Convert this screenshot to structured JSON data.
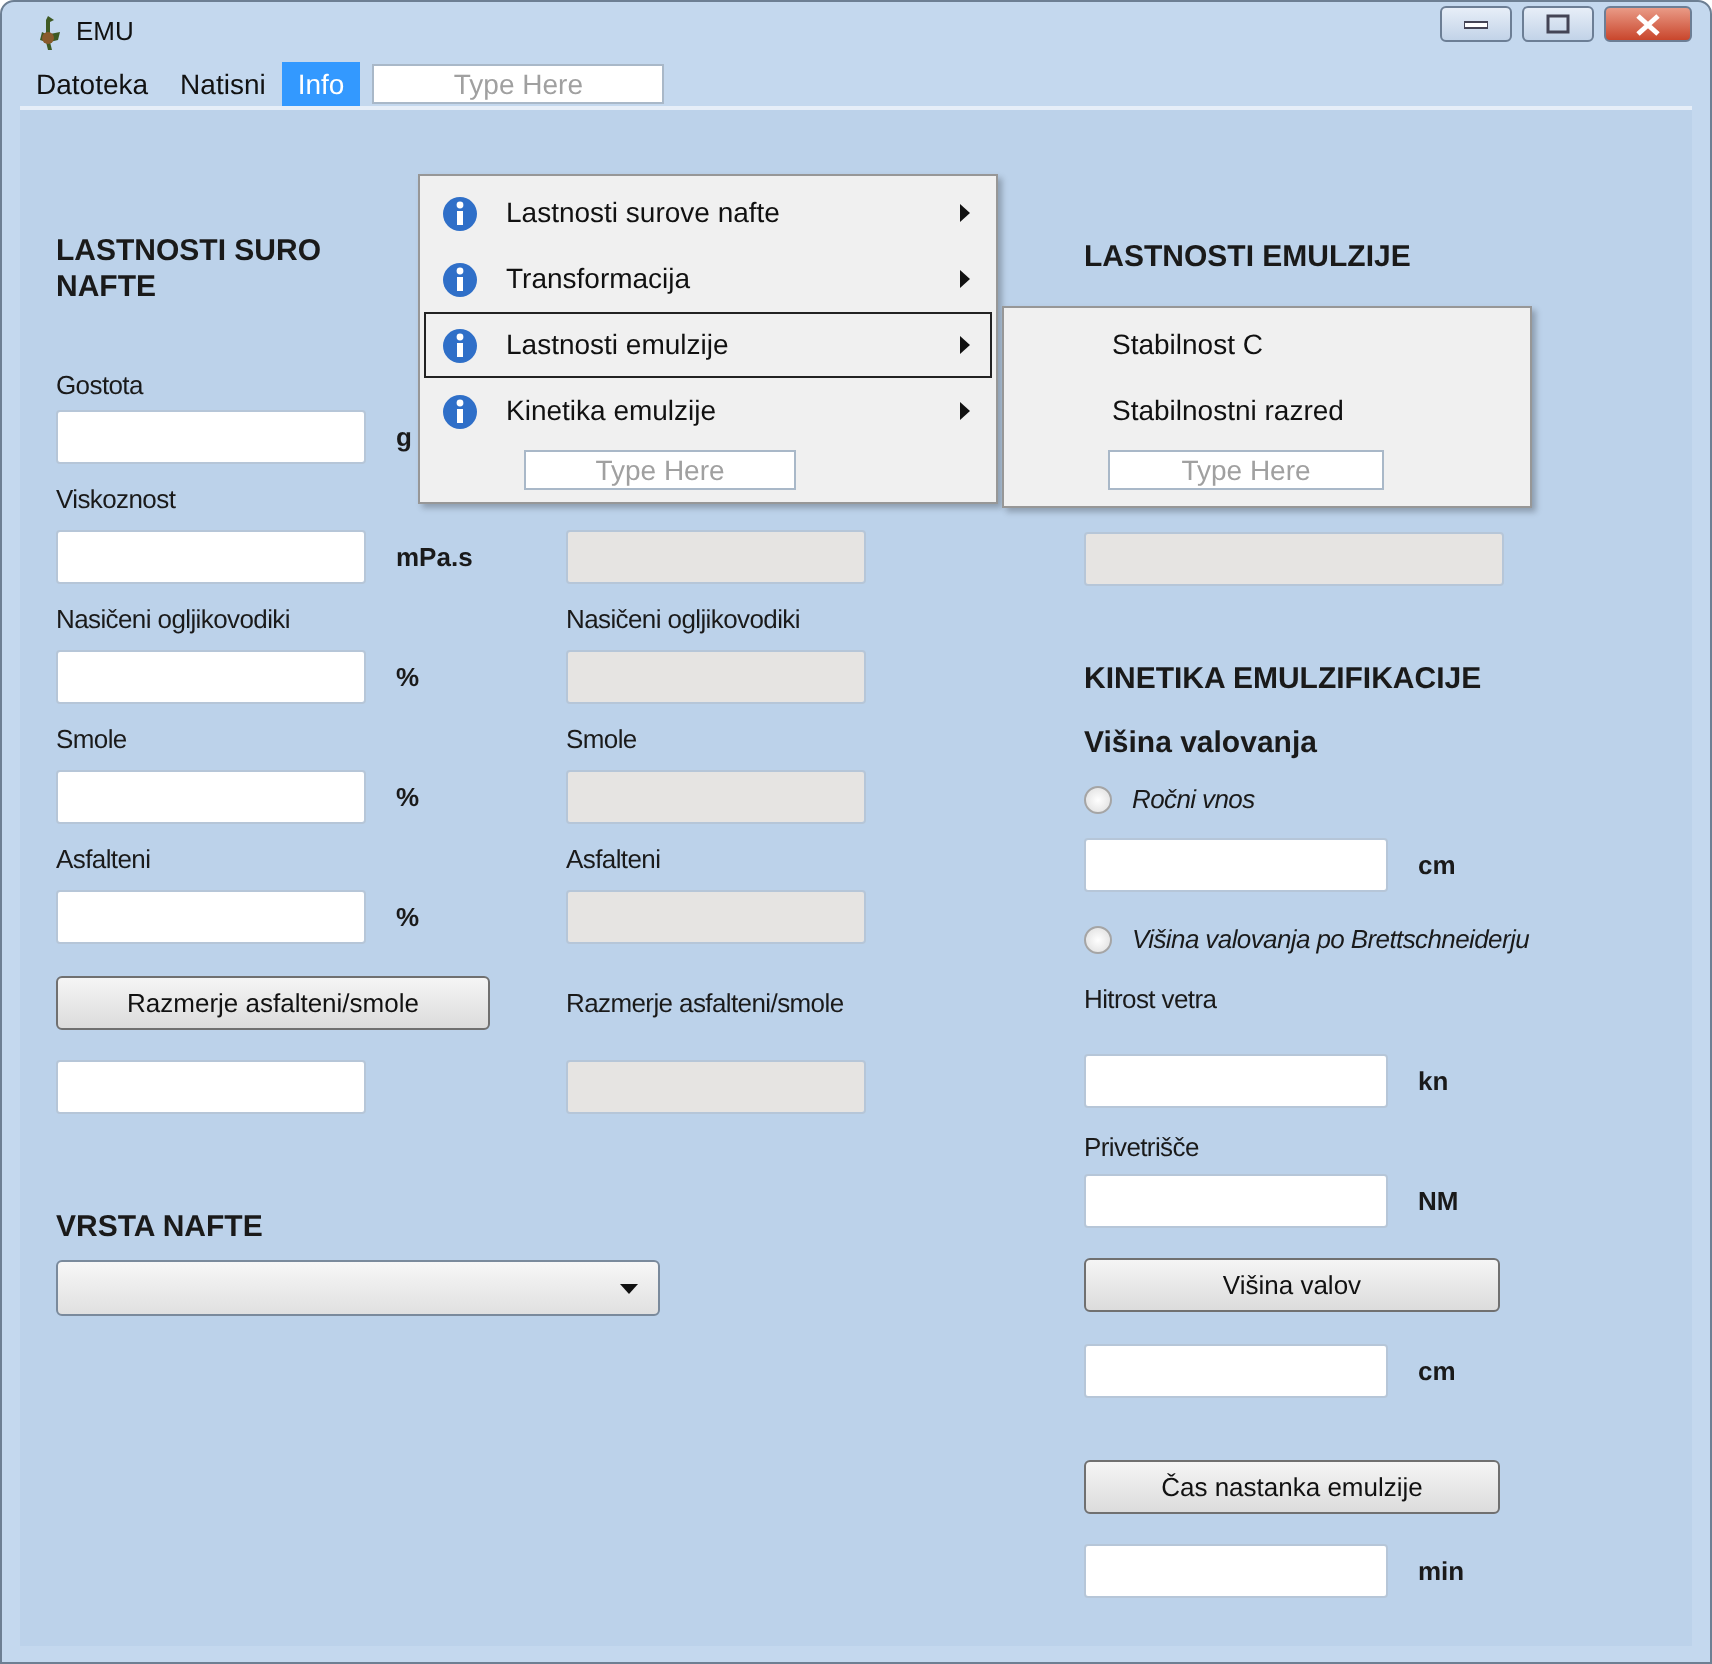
{
  "window": {
    "title": "EMU"
  },
  "menu_bar": {
    "items": [
      {
        "label": "Datoteka",
        "selected": false
      },
      {
        "label": "Natisni",
        "selected": false
      },
      {
        "label": "Info",
        "selected": true
      }
    ],
    "placeholder": "Type Here"
  },
  "info_menu": {
    "items": [
      {
        "label": "Lastnosti surove nafte",
        "selected": false
      },
      {
        "label": "Transformacija",
        "selected": false
      },
      {
        "label": "Lastnosti emulzije",
        "selected": true
      },
      {
        "label": "Kinetika emulzije",
        "selected": false
      }
    ],
    "placeholder": "Type Here"
  },
  "submenu": {
    "items": [
      {
        "label": "Stabilnost C"
      },
      {
        "label": "Stabilnostni razred"
      }
    ],
    "placeholder": "Type Here"
  },
  "columns": [
    {
      "items": [
        {
          "kind": "heading",
          "text": "LASTNOSTI SURO\nNAFTE"
        },
        {
          "kind": "label",
          "text": "Gostota"
        },
        {
          "kind": "field",
          "unit": "g",
          "disabled": false
        },
        {
          "kind": "label",
          "text": "Viskoznost"
        },
        {
          "kind": "field",
          "unit": "mPa.s",
          "disabled": false
        },
        {
          "kind": "label",
          "text": "Nasičeni ogljikovodiki"
        },
        {
          "kind": "field",
          "unit": "%",
          "disabled": false
        },
        {
          "kind": "label",
          "text": "Smole"
        },
        {
          "kind": "field",
          "unit": "%",
          "disabled": false
        },
        {
          "kind": "label",
          "text": "Asfalteni"
        },
        {
          "kind": "field",
          "unit": "%",
          "disabled": false
        },
        {
          "kind": "button",
          "text": "Razmerje asfalteni/smole"
        },
        {
          "kind": "field",
          "disabled": false
        },
        {
          "kind": "heading",
          "text": "VRSTA NAFTE"
        },
        {
          "kind": "select"
        }
      ]
    },
    {
      "items": [
        {
          "kind": "field",
          "disabled": true
        },
        {
          "kind": "label",
          "text": "Nasičeni ogljikovodiki"
        },
        {
          "kind": "field",
          "disabled": true
        },
        {
          "kind": "label",
          "text": "Smole"
        },
        {
          "kind": "field",
          "disabled": true
        },
        {
          "kind": "label",
          "text": "Asfalteni"
        },
        {
          "kind": "field",
          "disabled": true
        },
        {
          "kind": "label",
          "text": "Razmerje asfalteni/smole"
        },
        {
          "kind": "field",
          "disabled": true
        }
      ]
    },
    {
      "items": [
        {
          "kind": "heading",
          "text": "LASTNOSTI EMULZIJE"
        },
        {
          "kind": "field",
          "disabled": true
        },
        {
          "kind": "heading",
          "text": "KINETIKA EMULZIFIKACIJE"
        },
        {
          "kind": "subheading",
          "text": "Višina valovanja"
        },
        {
          "kind": "radio",
          "text": "Ročni vnos",
          "selected": false
        },
        {
          "kind": "field",
          "unit": "cm",
          "disabled": false
        },
        {
          "kind": "radio",
          "text": "Višina valovanja po Brettschneiderju",
          "selected": false
        },
        {
          "kind": "label",
          "text": "Hitrost vetra"
        },
        {
          "kind": "field",
          "unit": "kn",
          "disabled": false
        },
        {
          "kind": "label",
          "text": "Privetrišče"
        },
        {
          "kind": "field",
          "unit": "NM",
          "disabled": false
        },
        {
          "kind": "button",
          "text": "Višina valov"
        },
        {
          "kind": "field",
          "unit": "cm",
          "disabled": false
        },
        {
          "kind": "button",
          "text": "Čas nastanka emulzije"
        },
        {
          "kind": "field",
          "unit": "min",
          "disabled": false
        }
      ]
    }
  ]
}
